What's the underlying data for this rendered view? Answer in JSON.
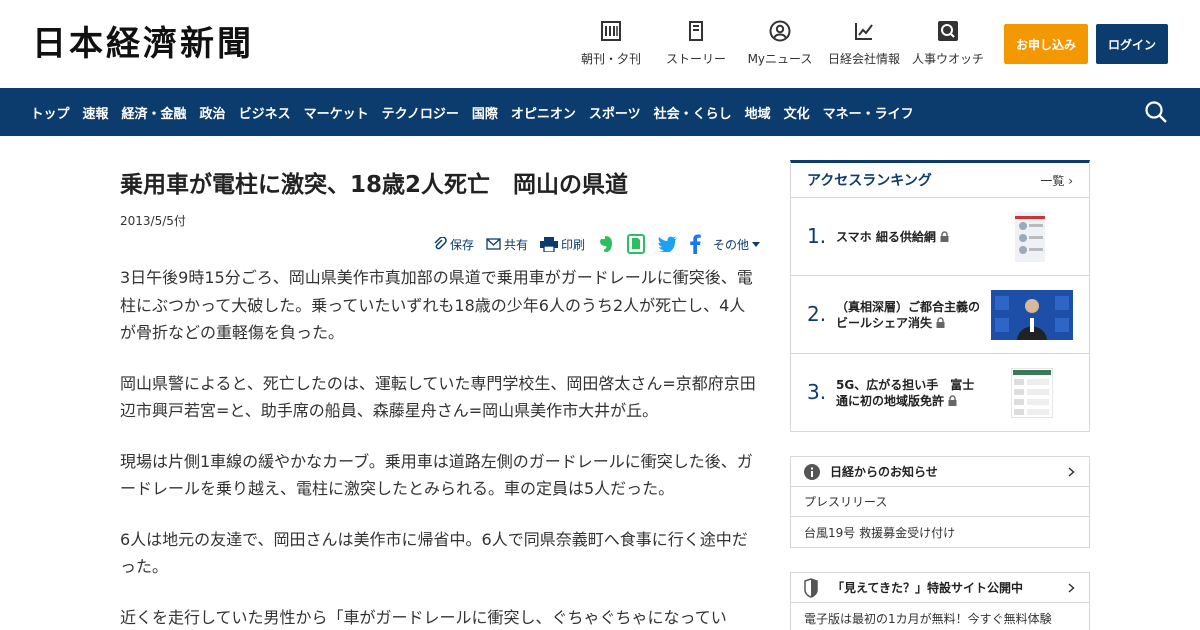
{
  "header": {
    "logo": "日本経濟新聞",
    "utils": [
      {
        "icon": "newspaper-icon",
        "label": "朝刊・夕刊"
      },
      {
        "icon": "story-icon",
        "label": "ストーリー"
      },
      {
        "icon": "user-icon",
        "label": "Myニュース"
      },
      {
        "icon": "company-chart-icon",
        "label": "日経会社情報"
      },
      {
        "icon": "search-person-icon",
        "label": "人事ウオッチ"
      }
    ],
    "apply_label": "お申し込み",
    "login_label": "ログイン"
  },
  "nav": {
    "items": [
      "トップ",
      "速報",
      "経済・金融",
      "政治",
      "ビジネス",
      "マーケット",
      "テクノロジー",
      "国際",
      "オピニオン",
      "スポーツ",
      "社会・くらし",
      "地域",
      "文化",
      "マネー・ライフ"
    ]
  },
  "article": {
    "title": "乗用車が電柱に激突、18歳2人死亡　岡山の県道",
    "date": "2013/5/5付",
    "tools": {
      "save": "保存",
      "share": "共有",
      "print": "印刷",
      "more": "その他"
    },
    "paragraphs": [
      "3日午後9時15分ごろ、岡山県美作市真加部の県道で乗用車がガードレールに衝突後、電柱にぶつかって大破した。乗っていたいずれも18歳の少年6人のうち2人が死亡し、4人が骨折などの重軽傷を負った。",
      "岡山県警によると、死亡したのは、運転していた専門学校生、岡田啓太さん=京都府京田辺市興戸若宮=と、助手席の船員、森藤星舟さん=岡山県美作市大井が丘。",
      "現場は片側1車線の緩やかなカーブ。乗用車は道路左側のガードレールに衝突した後、ガードレールを乗り越え、電柱に激突したとみられる。車の定員は5人だった。",
      "6人は地元の友達で、岡田さんは美作市に帰省中。6人で同県奈義町へ食事に行く途中だった。",
      "近くを走行していた男性から「車がガードレールに衝突し、ぐちゃぐちゃになってい"
    ]
  },
  "ranking": {
    "title": "アクセスランキング",
    "more": "一覧",
    "items": [
      {
        "num": "1.",
        "text": "スマホ 細る供給網"
      },
      {
        "num": "2.",
        "text": "（真相深層）ご都合主義のビールシェア消失"
      },
      {
        "num": "3.",
        "text": "5G、広がる担い手　富士通に初の地域版免許"
      }
    ]
  },
  "notices": {
    "title": "日経からのお知らせ",
    "items": [
      "プレスリリース",
      "台風19号 救援募金受け付け"
    ]
  },
  "special": {
    "title": "「見えてきた？」特設サイト公開中",
    "text": "電子版は最初の1カ月が無料！今すぐ無料体験"
  },
  "colors": {
    "navy": "#0c3c6e",
    "orange": "#f39800",
    "evernote": "#2dbe60",
    "twitter": "#1da1f2",
    "facebook": "#1877f2"
  }
}
